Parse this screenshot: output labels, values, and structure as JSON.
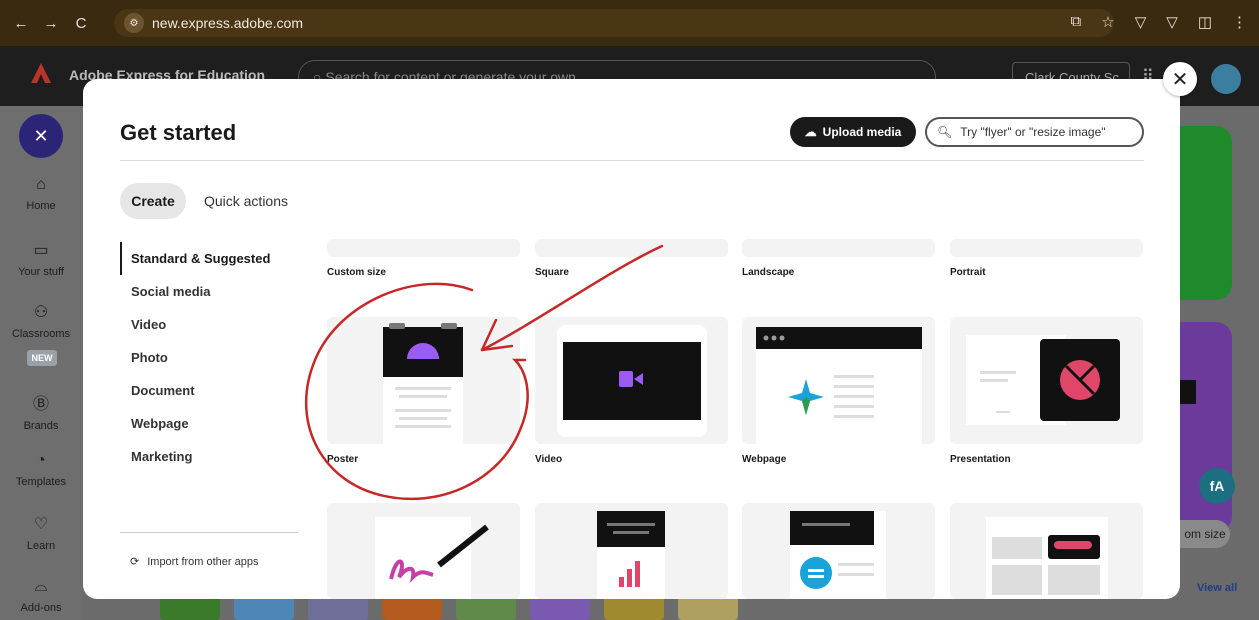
{
  "browser": {
    "url": "new.express.adobe.com",
    "nav_icons": [
      "back-icon",
      "forward-icon",
      "reload-icon"
    ]
  },
  "app": {
    "title": "Adobe Express for Education",
    "search_placeholder": "Search for content or generate your own",
    "org": "Clark County Sc"
  },
  "sidebar": {
    "items": [
      {
        "label": "Home",
        "icon": "home-icon"
      },
      {
        "label": "Your stuff",
        "icon": "folder-icon"
      },
      {
        "label": "Classrooms",
        "icon": "classroom-icon"
      },
      {
        "label": "Brands",
        "icon": "brand-icon"
      },
      {
        "label": "Templates",
        "icon": "templates-icon"
      },
      {
        "label": "Learn",
        "icon": "lightbulb-icon"
      },
      {
        "label": "Add-ons",
        "icon": "addons-icon"
      }
    ],
    "new_badge": "NEW"
  },
  "background": {
    "view_all": "View all",
    "custom_size_chip": "om size"
  },
  "modal": {
    "title": "Get started",
    "upload_label": "Upload media",
    "search_placeholder": "Try \"flyer\" or \"resize image\"",
    "tabs": [
      {
        "label": "Create",
        "active": true
      },
      {
        "label": "Quick actions",
        "active": false
      }
    ],
    "categories": [
      {
        "label": "Standard & Suggested",
        "active": true
      },
      {
        "label": "Social media"
      },
      {
        "label": "Video"
      },
      {
        "label": "Photo"
      },
      {
        "label": "Document"
      },
      {
        "label": "Webpage"
      },
      {
        "label": "Marketing"
      }
    ],
    "import_label": "Import from other apps",
    "row1": [
      "Custom size",
      "Square",
      "Landscape",
      "Portrait"
    ],
    "row2": [
      "Poster",
      "Video",
      "Webpage",
      "Presentation"
    ],
    "accent": "#c62828"
  }
}
